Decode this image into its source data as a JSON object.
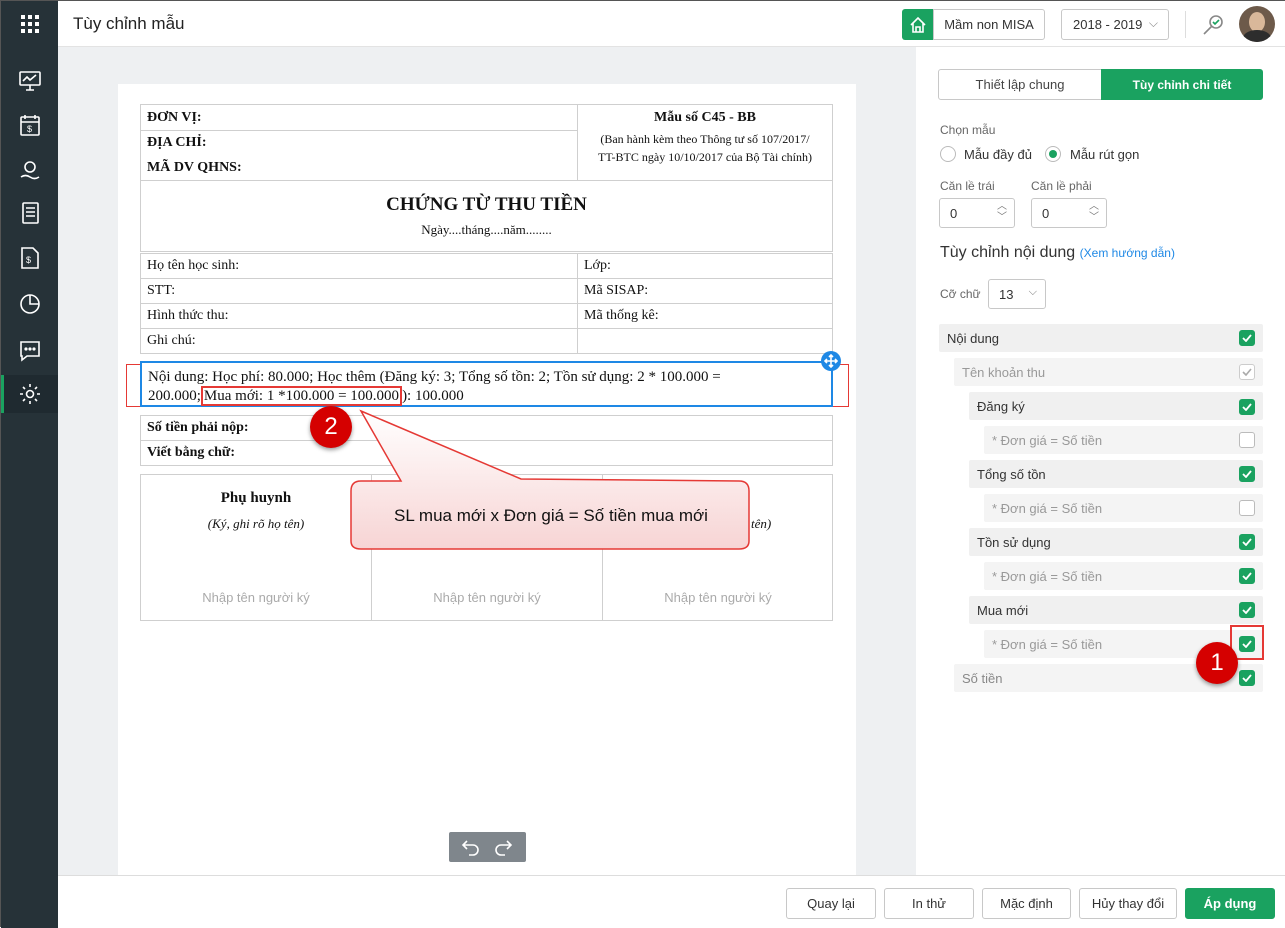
{
  "app": {
    "title": "Tùy chỉnh mẫu",
    "school": "Mầm non MISA",
    "year": "2018 - 2019"
  },
  "doc": {
    "don_vi": "ĐƠN VỊ:",
    "dia_chi": "ĐỊA CHỈ:",
    "ma_dv": "MÃ DV QHNS:",
    "mau_so": "Mẫu số C45 - BB",
    "ban_hanh_1": "(Ban hành kèm theo Thông tư số 107/2017/",
    "ban_hanh_2": "TT-BTC ngày 10/10/2017 của Bộ Tài chính)",
    "heading": "CHỨNG TỪ THU TIỀN",
    "date_line": "Ngày....tháng....năm........",
    "ho_ten": "Họ tên học sinh:",
    "lop": "Lớp:",
    "stt": "STT:",
    "ma_sisap": "Mã SISAP:",
    "hinh_thuc": "Hình thức thu:",
    "ma_thong_ke": "Mã thống kê:",
    "ghi_chu": "Ghi chú:",
    "noi_dung_1": "Nội dung: Học phí: 80.000; Học thêm (Đăng ký: 3; Tổng số tồn: 2; Tồn sử dụng: 2 * 100.000 =",
    "noi_dung_2a": "200.000;",
    "noi_dung_2b": "Mua mới: 1 *100.000 = 100.000",
    "noi_dung_2c": "): 100.000",
    "so_tien": "Số tiền phải nộp:",
    "viet_bang_chu": "Viết bằng chữ:",
    "phu_huynh": "Phụ huynh",
    "ky_ghi": "(Ký, ghi rõ họ tên)",
    "ky_ghi_partial": "tên)",
    "sign_placeholder": "Nhập tên người ký"
  },
  "callout": {
    "badge1": "1",
    "badge2": "2",
    "text": "SL mua mới x Đơn giá = Số tiền mua mới"
  },
  "panel": {
    "tab_general": "Thiết lập chung",
    "tab_detail": "Tùy chỉnh chi tiết",
    "chon_mau": "Chọn mẫu",
    "mau_day_du": "Mẫu đầy đủ",
    "mau_rut_gon": "Mẫu rút gọn",
    "can_le_trai": "Căn lề trái",
    "can_le_phai": "Căn lề phải",
    "le_trai_val": "0",
    "le_phai_val": "0",
    "tuy_chinh_nd": "Tùy chỉnh nội dung",
    "xem_hd": "(Xem hướng dẫn)",
    "co_chu": "Cỡ chữ",
    "co_chu_val": "13",
    "items": [
      "Nội dung",
      "Tên khoản thu",
      "Đăng ký",
      "* Đơn giá = Số tiền",
      "Tổng số tồn",
      "* Đơn giá = Số tiền",
      "Tồn sử dụng",
      "* Đơn giá = Số tiền",
      "Mua mới",
      "* Đơn giá = Số tiền",
      "Số tiền"
    ]
  },
  "footer": {
    "back": "Quay lại",
    "print": "In thử",
    "default": "Mặc định",
    "cancel": "Hủy thay đổi",
    "apply": "Áp dụng"
  },
  "colors": {
    "accent": "#1aa260",
    "rail": "#263238",
    "highlight": "#e53935",
    "select": "#1e88e5"
  }
}
